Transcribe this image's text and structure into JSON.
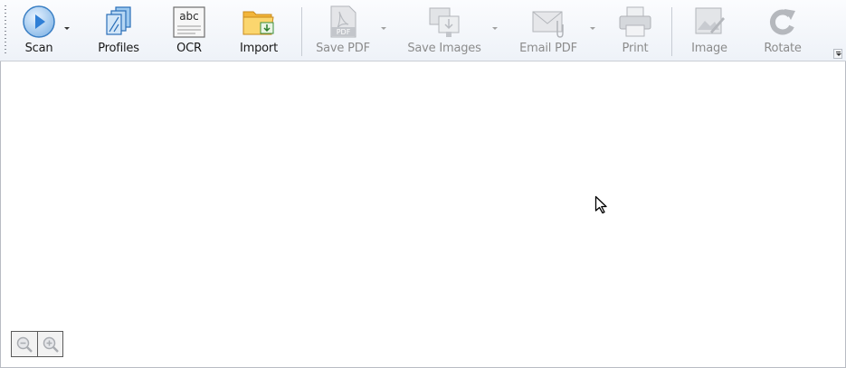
{
  "toolbar": {
    "buttons": [
      {
        "label": "Scan",
        "icon": "scan-icon",
        "enabled": true,
        "dropdown": true
      },
      {
        "label": "Profiles",
        "icon": "profiles-icon",
        "enabled": true
      },
      {
        "label": "OCR",
        "icon": "ocr-icon",
        "enabled": true,
        "icon_text": "abc"
      },
      {
        "label": "Import",
        "icon": "import-icon",
        "enabled": true
      },
      {
        "label": "Save PDF",
        "icon": "save-pdf-icon",
        "enabled": false,
        "dropdown": true,
        "icon_text": "PDF"
      },
      {
        "label": "Save Images",
        "icon": "save-images-icon",
        "enabled": false,
        "dropdown": true
      },
      {
        "label": "Email PDF",
        "icon": "email-pdf-icon",
        "enabled": false,
        "dropdown": true
      },
      {
        "label": "Print",
        "icon": "print-icon",
        "enabled": false
      },
      {
        "label": "Image",
        "icon": "image-icon",
        "enabled": false
      },
      {
        "label": "Rotate",
        "icon": "rotate-icon",
        "enabled": false
      }
    ]
  },
  "zoom": {
    "zoom_out_icon": "zoom-out-icon",
    "zoom_in_icon": "zoom-in-icon"
  },
  "colors": {
    "accent_blue": "#2f7fd6",
    "disabled_gray": "#a8acb3",
    "folder_yellow": "#f5c542"
  }
}
